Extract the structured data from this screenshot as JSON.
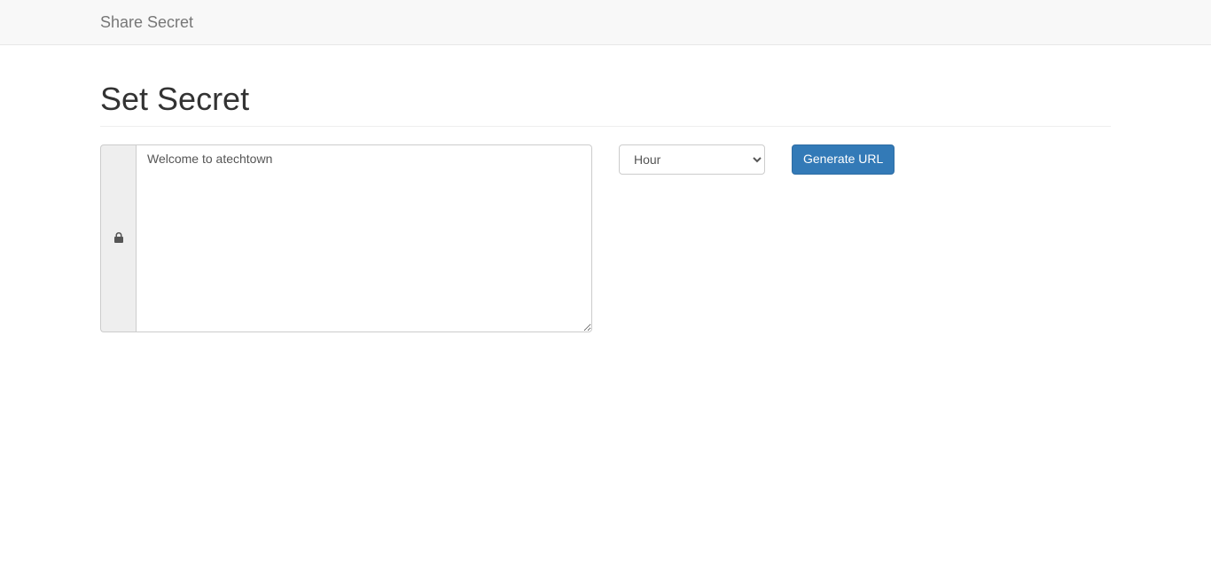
{
  "navbar": {
    "brand": "Share Secret"
  },
  "page": {
    "title": "Set Secret"
  },
  "form": {
    "secret_value": "Welcome to atechtown",
    "secret_placeholder": "",
    "ttl_selected": "Hour",
    "generate_label": "Generate URL"
  }
}
